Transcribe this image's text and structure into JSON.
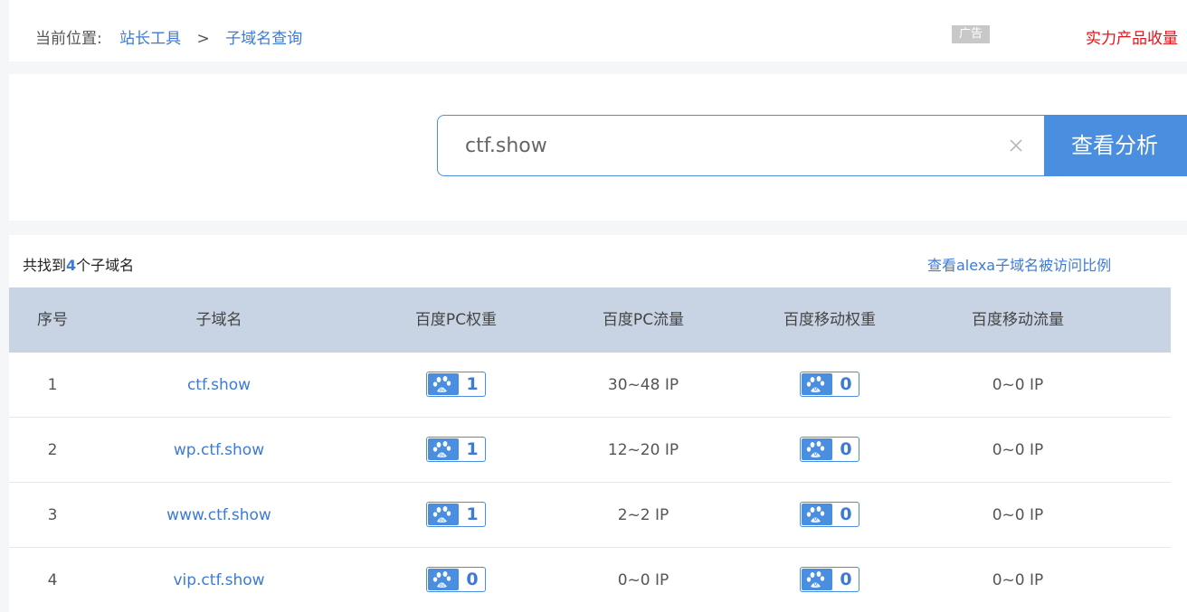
{
  "breadcrumb": {
    "label": "当前位置:",
    "items": [
      "站长工具",
      "子域名查询"
    ],
    "separator": ">"
  },
  "ad": {
    "tag": "广告",
    "text": "实力产品收量"
  },
  "search": {
    "value": "ctf.show",
    "button_label": "查看分析"
  },
  "results": {
    "found_prefix": "共找到",
    "found_count": "4",
    "found_suffix": "个子域名",
    "alexa_link": "查看alexa子域名被访问比例"
  },
  "table": {
    "headers": [
      "序号",
      "子域名",
      "百度PC权重",
      "百度PC流量",
      "百度移动权重",
      "百度移动流量"
    ],
    "rows": [
      {
        "index": "1",
        "domain": "ctf.show",
        "pc_weight": "1",
        "pc_traffic": "30~48 IP",
        "mobile_weight": "0",
        "mobile_traffic": "0~0 IP"
      },
      {
        "index": "2",
        "domain": "wp.ctf.show",
        "pc_weight": "1",
        "pc_traffic": "12~20 IP",
        "mobile_weight": "0",
        "mobile_traffic": "0~0 IP"
      },
      {
        "index": "3",
        "domain": "www.ctf.show",
        "pc_weight": "1",
        "pc_traffic": "2~2 IP",
        "mobile_weight": "0",
        "mobile_traffic": "0~0 IP"
      },
      {
        "index": "4",
        "domain": "vip.ctf.show",
        "pc_weight": "0",
        "pc_traffic": "0~0 IP",
        "mobile_weight": "0",
        "mobile_traffic": "0~0 IP"
      }
    ]
  },
  "colors": {
    "accent": "#4a8ee0",
    "link": "#3d7ad6",
    "header_bg": "#c8d3e3",
    "ad_red": "#e4151a"
  },
  "icons": {
    "clear": "close-icon",
    "pc_weight": "baidu-paw-icon",
    "mobile_weight": "baidu-mobile-paw-icon"
  }
}
